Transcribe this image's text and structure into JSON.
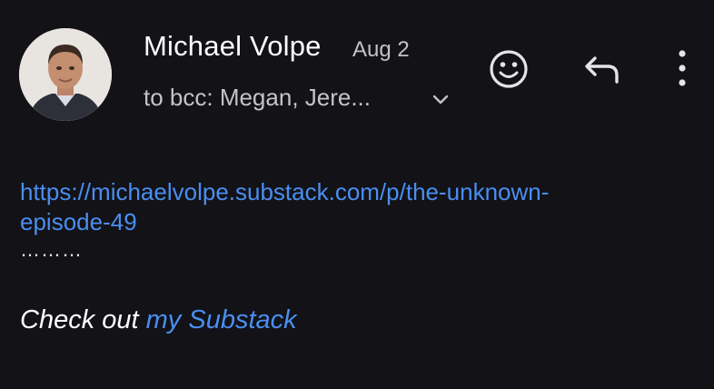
{
  "header": {
    "sender_name": "Michael Volpe",
    "date": "Aug 2",
    "recipients": "to bcc: Megan, Jere...",
    "icons": {
      "expand": "chevron-down-icon",
      "emoji": "emoji-icon",
      "reply": "reply-icon",
      "more": "more-vertical-icon"
    }
  },
  "body": {
    "link_line1": "https://michaelvolpe.substack.com/p/the-unknown-",
    "link_line2": "episode-49",
    "dots": "………",
    "signature_text": "Check out ",
    "signature_link": "my Substack"
  },
  "colors": {
    "background": "#121217",
    "link": "#4a8ef0",
    "secondary_text": "#c3c3c8"
  }
}
